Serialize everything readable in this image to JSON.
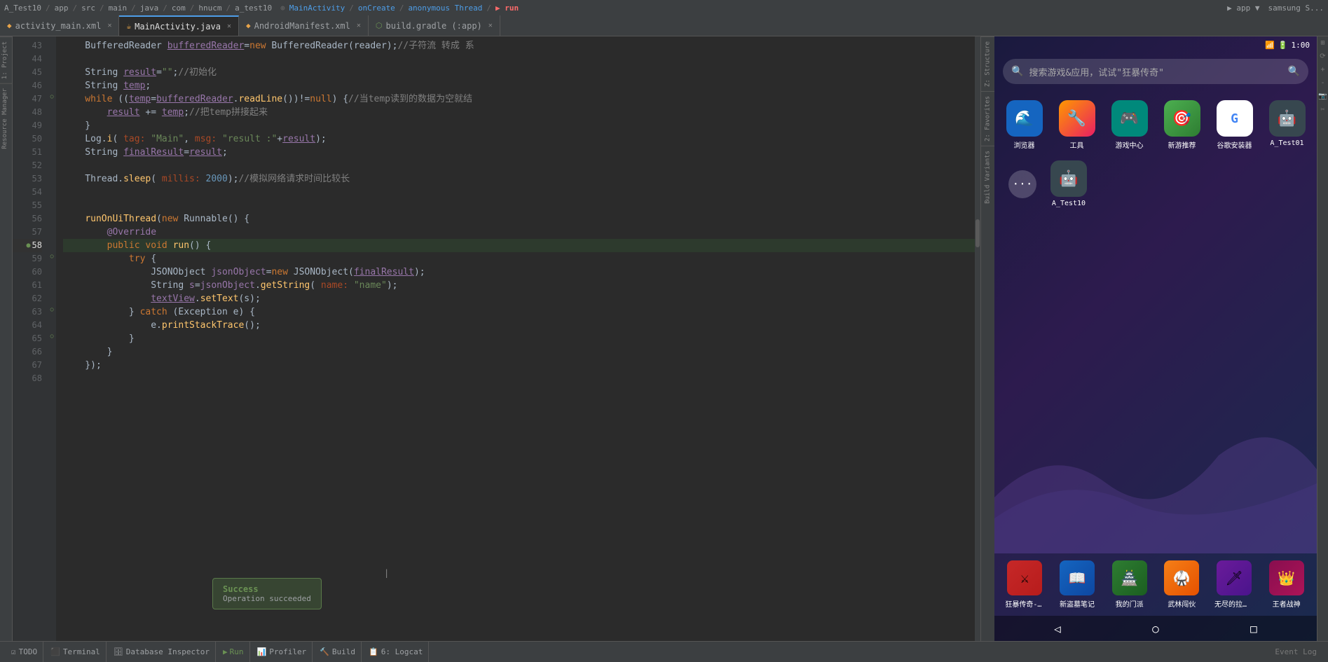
{
  "topbar": {
    "project": "A_Test10",
    "breadcrumb": [
      "app",
      "src",
      "main",
      "java",
      "com",
      "hnucm",
      "a_test10"
    ],
    "files": [
      "MainActivity",
      "onCreate",
      "anonymous Thread",
      "run"
    ],
    "device": "app",
    "device2": "samsung S"
  },
  "tabs": [
    {
      "id": "activity_main",
      "label": "activity_main.xml",
      "icon": "xml",
      "active": false
    },
    {
      "id": "mainactivity",
      "label": "MainActivity.java",
      "icon": "java",
      "active": true
    },
    {
      "id": "androidmanifest",
      "label": "AndroidManifest.xml",
      "icon": "xml",
      "active": false
    },
    {
      "id": "build_gradle",
      "label": "build.gradle (:app)",
      "icon": "gradle",
      "active": false
    }
  ],
  "left_panels": [
    {
      "id": "project",
      "label": "1: Project"
    },
    {
      "id": "resource_manager",
      "label": "Resource Manager"
    },
    {
      "id": "z_structure",
      "label": "Z: Structure"
    },
    {
      "id": "favorites",
      "label": "2: Favorites"
    },
    {
      "id": "build_variants",
      "label": "Build Variants"
    }
  ],
  "code": {
    "lines": [
      {
        "num": 43,
        "content": "    BufferedReader bufferedReader=new BufferedReader(reader);//子符流 转成 系"
      },
      {
        "num": 44,
        "content": ""
      },
      {
        "num": 45,
        "content": "    String result=\"\";//初始化"
      },
      {
        "num": 46,
        "content": "    String temp;"
      },
      {
        "num": 47,
        "content": "    while ((temp=bufferedReader.readLine())!=null) {//当temp读到的数据为空就结"
      },
      {
        "num": 48,
        "content": "        result += temp;//把temp拼接起来"
      },
      {
        "num": 49,
        "content": "    }"
      },
      {
        "num": 50,
        "content": "    Log.i( tag: \"Main\", msg: \"result :\"+result);"
      },
      {
        "num": 51,
        "content": "    String finalResult=result;"
      },
      {
        "num": 52,
        "content": ""
      },
      {
        "num": 53,
        "content": "    Thread.sleep( millis: 2000);//模拟网络请求时间比较长"
      },
      {
        "num": 54,
        "content": ""
      },
      {
        "num": 55,
        "content": ""
      },
      {
        "num": 56,
        "content": "    runOnUiThread(new Runnable() {"
      },
      {
        "num": 57,
        "content": "        @Override"
      },
      {
        "num": 58,
        "content": "        public void run() {",
        "active": true,
        "has_icon": true
      },
      {
        "num": 59,
        "content": "            try {"
      },
      {
        "num": 60,
        "content": "                JSONObject jsonObject=new JSONObject(finalResult);"
      },
      {
        "num": 61,
        "content": "                String s=jsonObject.getString( name: \"name\");"
      },
      {
        "num": 62,
        "content": "                textView.setText(s);"
      },
      {
        "num": 63,
        "content": "            } catch (Exception e) {"
      },
      {
        "num": 64,
        "content": "                e.printStackTrace();"
      },
      {
        "num": 65,
        "content": "            }"
      },
      {
        "num": 66,
        "content": "        }"
      },
      {
        "num": 67,
        "content": "    });"
      },
      {
        "num": 68,
        "content": ""
      }
    ]
  },
  "toast": {
    "title": "Success",
    "message": "Operation succeeded"
  },
  "bottom_tabs": [
    {
      "id": "todo",
      "label": "TODO"
    },
    {
      "id": "terminal",
      "label": "Terminal"
    },
    {
      "id": "db_inspector",
      "label": "Database Inspector"
    },
    {
      "id": "run",
      "label": "Run",
      "icon": "run"
    },
    {
      "id": "profiler",
      "label": "Profiler"
    },
    {
      "id": "build",
      "label": "Build"
    },
    {
      "id": "logcat",
      "label": "6: Logcat"
    }
  ],
  "device": {
    "time": "1:00",
    "search_placeholder": "搜索游戏&应用，试试\"狂暴传奇\"",
    "apps_row1": [
      {
        "id": "browser",
        "label": "浏览器",
        "color": "#1565c0",
        "icon": "🌊"
      },
      {
        "id": "tools",
        "label": "工具",
        "color": "#ff9800",
        "icon": "🔧"
      },
      {
        "id": "gamecenter",
        "label": "游戏中心",
        "color": "#00897b",
        "icon": "🎮"
      },
      {
        "id": "newgame",
        "label": "新游推荐",
        "color": "#388e3c",
        "icon": "🎯"
      },
      {
        "id": "google",
        "label": "谷歌安装器",
        "color": "white",
        "icon": "G"
      },
      {
        "id": "atest01",
        "label": "A_Test01",
        "color": "#37474f",
        "icon": "🤖"
      }
    ],
    "apps_row2": [
      {
        "id": "atest10",
        "label": "A_Test10",
        "color": "#37474f",
        "icon": "🤖"
      }
    ],
    "bottom_apps": [
      {
        "id": "game1",
        "label": "狂暴传奇-微...",
        "color": "#c62828",
        "icon": "⚔"
      },
      {
        "id": "game2",
        "label": "新盗墓笔记",
        "color": "#1565c0",
        "icon": "📖"
      },
      {
        "id": "game3",
        "label": "我的门派",
        "color": "#2e7d32",
        "icon": "🏯"
      },
      {
        "id": "game4",
        "label": "武林闯伙",
        "color": "#f57f17",
        "icon": "🥋"
      },
      {
        "id": "game5",
        "label": "无尽的拉格...",
        "color": "#6a1b9a",
        "icon": "🗡"
      },
      {
        "id": "game6",
        "label": "王者战神",
        "color": "#880e4f",
        "icon": "👑"
      }
    ]
  },
  "right_panel": {
    "buttons": [
      "⊕",
      "🔊",
      "🔇",
      "📱",
      "🔲",
      "✂"
    ]
  }
}
